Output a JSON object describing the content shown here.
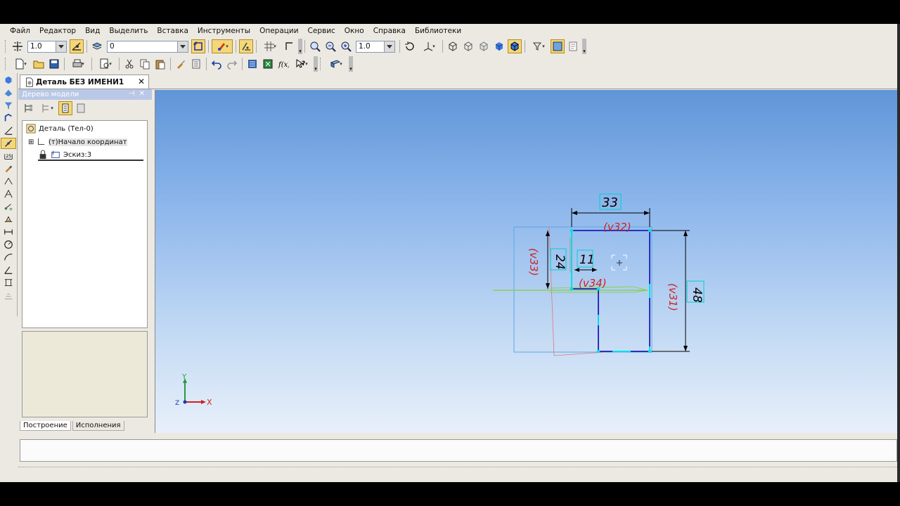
{
  "menu": [
    "Файл",
    "Редактор",
    "Вид",
    "Выделить",
    "Вставка",
    "Инструменты",
    "Операции",
    "Сервис",
    "Окно",
    "Справка",
    "Библиотеки"
  ],
  "toolbar1": {
    "step_value": "1.0",
    "layer_value": "0",
    "zoom_value": "1.0"
  },
  "doc_tab": {
    "title": "Деталь БЕЗ ИМЕНИ1",
    "close": "✕"
  },
  "tree": {
    "header": "Дерево модели",
    "items": [
      {
        "label": "Деталь (Тел-0)"
      },
      {
        "label": "(т)Начало координат"
      },
      {
        "label": "Эскиз:3"
      }
    ],
    "tabs": [
      "Построение",
      "Исполнения"
    ]
  },
  "sketch": {
    "dim_top": "33",
    "dim_right": "48",
    "dim_left_small": "24",
    "dim_inner": "11",
    "var_top": "(v32)",
    "var_left": "(v33)",
    "var_right": "(v31)",
    "var_inner": "(v34)"
  },
  "axes": {
    "x": "X",
    "y": "Y",
    "z": "Z"
  },
  "colors": {
    "accent": "#f3d77a",
    "sketch_line": "#1c1cb4",
    "dimension": "#000000",
    "variable": "#d02020",
    "highlight": "#00e0e0"
  }
}
